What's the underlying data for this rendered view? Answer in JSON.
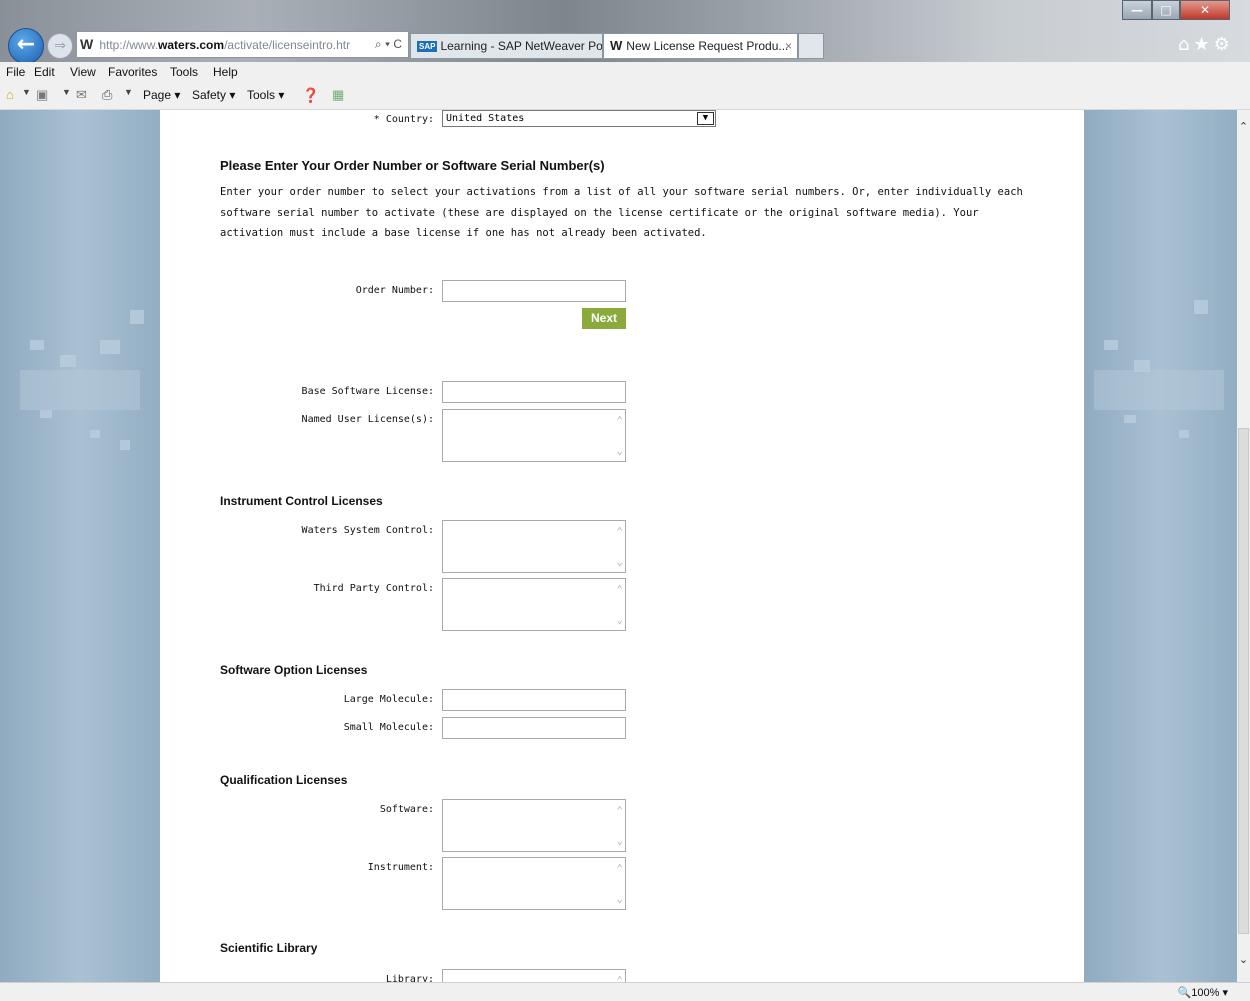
{
  "browser": {
    "address": {
      "url_prefix": "http://www.",
      "url_domain": "waters.com",
      "url_path": "/activate/licenseintro.htr",
      "actions": "⌕ ▾ C"
    },
    "tabs": [
      {
        "label": "Learning - SAP NetWeaver Por..."
      },
      {
        "label": "New License Request Produ..."
      }
    ],
    "menu": [
      "File",
      "Edit",
      "View",
      "Favorites",
      "Tools",
      "Help"
    ],
    "commands": [
      "Page ▾",
      "Safety ▾",
      "Tools ▾"
    ],
    "zoom": "100%"
  },
  "form": {
    "country_label": "* Country:",
    "country_value": "United States",
    "order_heading": "Please Enter Your Order Number or Software Serial Number(s)",
    "instructions": "Enter your order number to select your activations from a list of all your software serial numbers. Or, enter individually each software serial number to activate (these are displayed on the license certificate or the original software media). Your activation must include a base license if one has not already been activated.",
    "order_number_label": "Order Number:",
    "next_label": "Next",
    "base_license_label": "Base Software License:",
    "named_user_label": "Named User License(s):",
    "instrument_heading": "Instrument Control Licenses",
    "waters_control_label": "Waters System Control:",
    "third_party_label": "Third Party Control:",
    "software_option_heading": "Software Option Licenses",
    "large_molecule_label": "Large Molecule:",
    "small_molecule_label": "Small Molecule:",
    "qualification_heading": "Qualification Licenses",
    "software_label": "Software:",
    "instrument_label": "Instrument:",
    "library_heading": "Scientific Library",
    "library_label": "Library:"
  }
}
